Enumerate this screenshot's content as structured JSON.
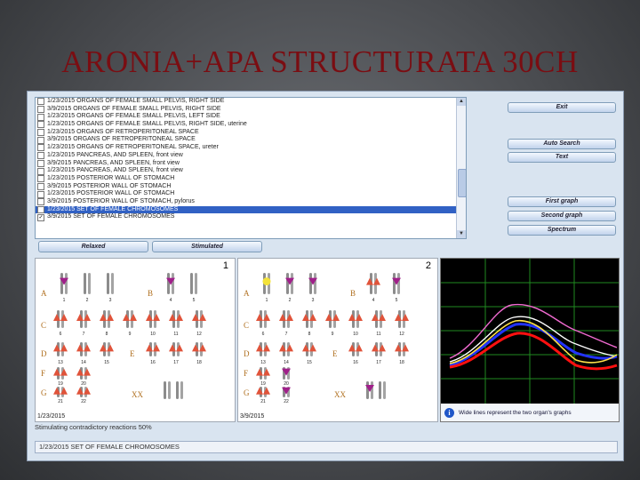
{
  "slide": {
    "title": "ARONIA+APA STRUCTURATA 30CH"
  },
  "list": {
    "items": [
      {
        "text": "1/23/2015  ORGANS OF FEMALE SMALL PELVIS, RIGHT SIDE",
        "checked": false,
        "selected": false
      },
      {
        "text": "3/9/2015  ORGANS OF FEMALE SMALL PELVIS, RIGHT SIDE",
        "checked": false,
        "selected": false
      },
      {
        "text": "1/23/2015  ORGANS OF FEMALE SMALL PELVIS, LEFT SIDE",
        "checked": false,
        "selected": false
      },
      {
        "text": "1/23/2015  ORGANS OF FEMALE SMALL PELVIS, RIGHT SIDE, uterine",
        "checked": false,
        "selected": false
      },
      {
        "text": "1/23/2015  ORGANS OF RETROPERITONEAL SPACE",
        "checked": false,
        "selected": false
      },
      {
        "text": "3/9/2015  ORGANS OF RETROPERITONEAL SPACE",
        "checked": false,
        "selected": false
      },
      {
        "text": "1/23/2015  ORGANS OF RETROPERITONEAL SPACE, ureter",
        "checked": false,
        "selected": false
      },
      {
        "text": "1/23/2015  PANCREAS, AND SPLEEN, front view",
        "checked": false,
        "selected": false
      },
      {
        "text": "3/9/2015  PANCREAS, AND SPLEEN, front view",
        "checked": false,
        "selected": false
      },
      {
        "text": "1/23/2015  PANCREAS, AND SPLEEN, front view",
        "checked": false,
        "selected": false
      },
      {
        "text": "1/23/2015  POSTERIOR WALL OF STOMACH",
        "checked": false,
        "selected": false
      },
      {
        "text": "3/9/2015  POSTERIOR WALL OF STOMACH",
        "checked": false,
        "selected": false
      },
      {
        "text": "1/23/2015  POSTERIOR WALL OF STOMACH",
        "checked": false,
        "selected": false
      },
      {
        "text": "3/9/2015  POSTERIOR WALL OF STOMACH, pylorus",
        "checked": false,
        "selected": false
      },
      {
        "text": "1/23/2015  SET OF FEMALE CHROMOSOMES",
        "checked": false,
        "selected": true
      },
      {
        "text": "3/9/2015  SET OF FEMALE CHROMOSOMES",
        "checked": true,
        "selected": false
      }
    ],
    "scroll_up_icon": "triangle-up-icon",
    "scroll_down_icon": "triangle-down-icon"
  },
  "buttons": {
    "exit": "Exit",
    "auto_search": "Auto Search",
    "text": "Text",
    "first_graph": "First graph",
    "second_graph": "Second graph",
    "spectrum": "Spectrum",
    "relaxed": "Relaxed",
    "stimulated": "Stimulated"
  },
  "karyotype": {
    "panel1": {
      "number": "1",
      "date": "1/23/2015"
    },
    "panel2": {
      "number": "2",
      "date": "3/9/2015"
    },
    "groups": [
      "A",
      "B",
      "C",
      "D",
      "E",
      "F",
      "G",
      "XX"
    ],
    "row1_nums": [
      "1",
      "2",
      "3",
      "4",
      "5"
    ],
    "row2_nums": [
      "6",
      "7",
      "8",
      "9",
      "10",
      "11",
      "12"
    ],
    "row3_nums": [
      "13",
      "14",
      "15",
      "16",
      "17",
      "18"
    ],
    "row4_nums": [
      "19",
      "20"
    ],
    "row5_nums": [
      "21",
      "22"
    ],
    "marker_colors": {
      "up": "#e0533a",
      "down": "#a0208a",
      "yellow": "#f3e23a"
    }
  },
  "graph": {
    "info_icon": "info-icon",
    "info_text": "Wide lines represent the two organ's graphs",
    "colors": {
      "grid": "#1f8a1f",
      "white": "#ffffff",
      "pink": "#f06ad0",
      "blue": "#2233ff",
      "red": "#ff1010",
      "yellow": "#ffe14a",
      "black_line": "#000000"
    }
  },
  "status": {
    "line1": "Stimulating contradictory reactions 50%",
    "line2": "1/23/2015 SET OF FEMALE CHROMOSOMES"
  }
}
